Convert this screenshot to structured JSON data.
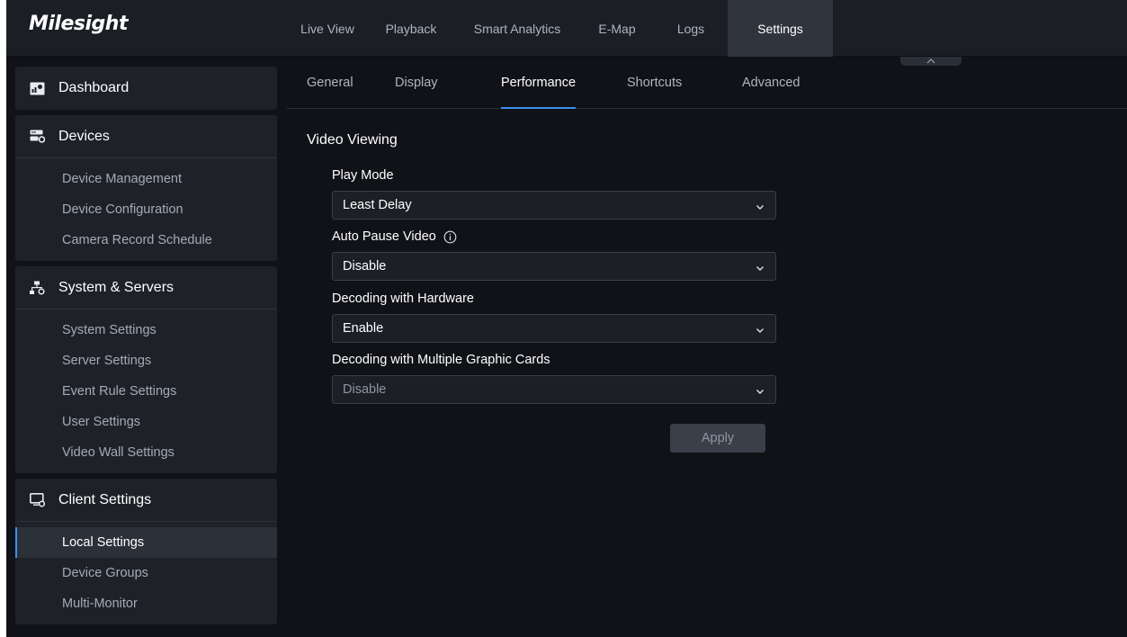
{
  "app": {
    "logo": "Milesight"
  },
  "nav": {
    "tabs": [
      {
        "label": "Live View"
      },
      {
        "label": "Playback"
      },
      {
        "label": "Smart Analytics"
      },
      {
        "label": "E-Map"
      },
      {
        "label": "Logs"
      },
      {
        "label": "Settings",
        "active": true
      }
    ]
  },
  "sidebar": {
    "groups": [
      {
        "label": "Dashboard",
        "icon": "dashboard-icon",
        "items": []
      },
      {
        "label": "Devices",
        "icon": "devices-icon",
        "items": [
          {
            "label": "Device Management"
          },
          {
            "label": "Device Configuration"
          },
          {
            "label": "Camera Record Schedule"
          }
        ]
      },
      {
        "label": "System & Servers",
        "icon": "system-servers-icon",
        "items": [
          {
            "label": "System Settings"
          },
          {
            "label": "Server Settings"
          },
          {
            "label": "Event Rule Settings"
          },
          {
            "label": "User Settings"
          },
          {
            "label": "Video Wall Settings"
          }
        ]
      },
      {
        "label": "Client Settings",
        "icon": "client-settings-icon",
        "items": [
          {
            "label": "Local Settings",
            "active": true
          },
          {
            "label": "Device Groups"
          },
          {
            "label": "Multi-Monitor"
          }
        ]
      }
    ]
  },
  "subtabs": [
    {
      "label": "General"
    },
    {
      "label": "Display"
    },
    {
      "label": "Performance",
      "active": true
    },
    {
      "label": "Shortcuts"
    },
    {
      "label": "Advanced"
    }
  ],
  "main": {
    "section_title": "Video Viewing",
    "fields": [
      {
        "label": "Play Mode",
        "value": "Least Delay"
      },
      {
        "label": "Auto Pause Video",
        "value": "Disable",
        "has_info": true
      },
      {
        "label": "Decoding with Hardware",
        "value": "Enable"
      },
      {
        "label": "Decoding with Multiple Graphic Cards",
        "value": "Disable",
        "disabled": true
      }
    ],
    "apply_label": "Apply"
  },
  "colors": {
    "accent": "#3d8ef0",
    "background": "#101217",
    "panel": "#1e2128",
    "topbar": "#1b1e25"
  }
}
